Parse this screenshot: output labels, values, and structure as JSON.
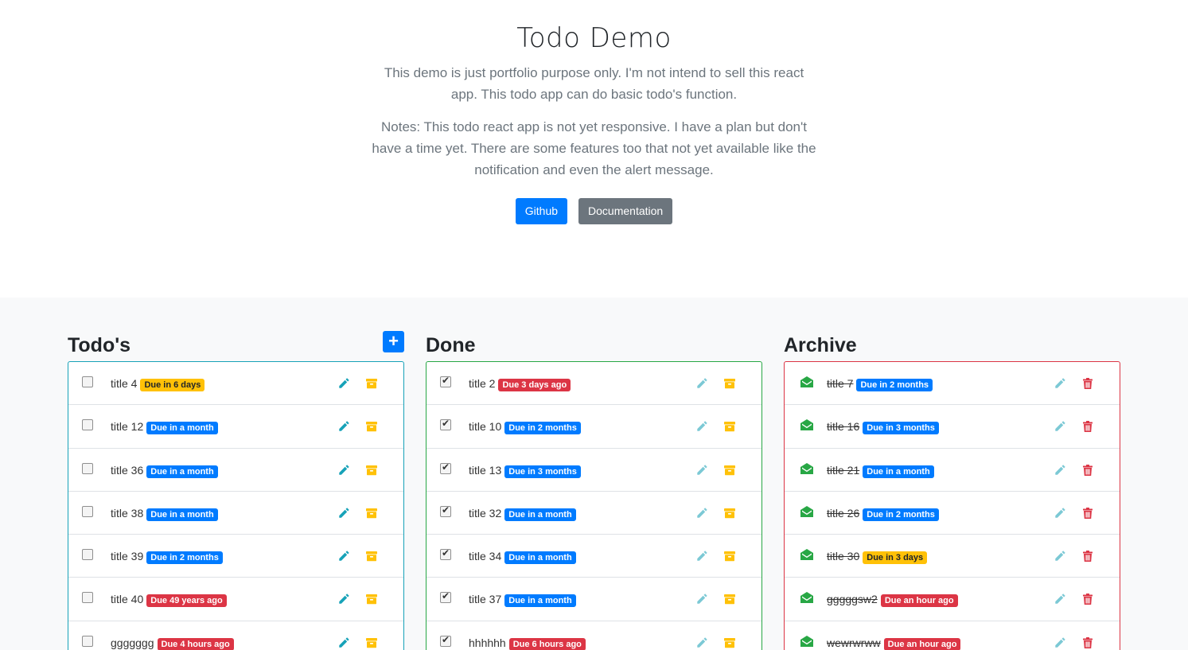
{
  "hero": {
    "title": "Todo Demo",
    "desc": "This demo is just portfolio purpose only. I'm not intend to sell this react app. This todo app can do basic todo's function.",
    "notes": "Notes: This todo react app is not yet responsive. I have a plan but don't have a time yet. There are some features too that not yet available like the notification and even the alert message.",
    "github_label": "Github",
    "docs_label": "Documentation"
  },
  "columns": {
    "todo": {
      "title": "Todo's",
      "add_label": "+",
      "items": [
        {
          "title": "title 4",
          "badge": "Due in 6 days",
          "badge_type": "warning"
        },
        {
          "title": "title 12",
          "badge": "Due in a month",
          "badge_type": "primary"
        },
        {
          "title": "title 36",
          "badge": "Due in a month",
          "badge_type": "primary"
        },
        {
          "title": "title 38",
          "badge": "Due in a month",
          "badge_type": "primary"
        },
        {
          "title": "title 39",
          "badge": "Due in 2 months",
          "badge_type": "primary"
        },
        {
          "title": "title 40",
          "badge": "Due 49 years ago",
          "badge_type": "danger"
        },
        {
          "title": "ggggggg",
          "badge": "Due 4 hours ago",
          "badge_type": "danger"
        }
      ]
    },
    "done": {
      "title": "Done",
      "items": [
        {
          "title": "title 2",
          "badge": "Due 3 days ago",
          "badge_type": "danger"
        },
        {
          "title": "title 10",
          "badge": "Due in 2 months",
          "badge_type": "primary"
        },
        {
          "title": "title 13",
          "badge": "Due in 3 months",
          "badge_type": "primary"
        },
        {
          "title": "title 32",
          "badge": "Due in a month",
          "badge_type": "primary"
        },
        {
          "title": "title 34",
          "badge": "Due in a month",
          "badge_type": "primary"
        },
        {
          "title": "title 37",
          "badge": "Due in a month",
          "badge_type": "primary"
        },
        {
          "title": "hhhhhh",
          "badge": "Due 6 hours ago",
          "badge_type": "danger"
        }
      ]
    },
    "archive": {
      "title": "Archive",
      "items": [
        {
          "title": "title 7",
          "badge": "Due in 2 months",
          "badge_type": "primary"
        },
        {
          "title": "title 16",
          "badge": "Due in 3 months",
          "badge_type": "primary"
        },
        {
          "title": "title 21",
          "badge": "Due in a month",
          "badge_type": "primary"
        },
        {
          "title": "title 26",
          "badge": "Due in 2 months",
          "badge_type": "primary"
        },
        {
          "title": "title 30",
          "badge": "Due in 3 days",
          "badge_type": "warning"
        },
        {
          "title": "gggggsw2",
          "badge": "Due an hour ago",
          "badge_type": "danger"
        },
        {
          "title": "wewrwrww",
          "badge": "Due an hour ago",
          "badge_type": "danger"
        }
      ]
    }
  },
  "colors": {
    "primary": "#007bff",
    "secondary": "#6c757d",
    "info": "#17a2b8",
    "success": "#28a745",
    "danger": "#dc3545",
    "warning": "#ffc107"
  },
  "icons": {
    "edit": "pencil-icon",
    "archive": "archive-box-icon",
    "delete": "trash-icon",
    "restore": "envelope-open-icon"
  }
}
